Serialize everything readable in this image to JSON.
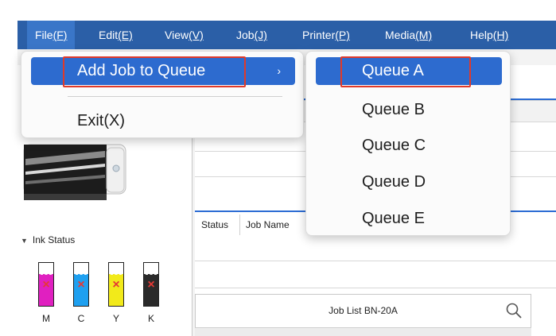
{
  "menubar": {
    "items": [
      {
        "label": "File",
        "key": "(F)"
      },
      {
        "label": "Edit",
        "key": "(E)"
      },
      {
        "label": "View",
        "key": "(V)"
      },
      {
        "label": "Job",
        "key": "(J)"
      },
      {
        "label": "Printer",
        "key": "(P)"
      },
      {
        "label": "Media",
        "key": "(M)"
      },
      {
        "label": "Help",
        "key": "(H)"
      }
    ]
  },
  "file_menu": {
    "add_job": "Add Job to Queue",
    "exit": "Exit(X)",
    "submenu_arrow": "›"
  },
  "queue_menu": {
    "items": [
      "Queue A",
      "Queue B",
      "Queue C",
      "Queue D",
      "Queue E"
    ]
  },
  "ink": {
    "title": "Ink Status",
    "cartridges": [
      {
        "label": "M",
        "color": "#e020c0"
      },
      {
        "label": "C",
        "color": "#1ea0f0"
      },
      {
        "label": "Y",
        "color": "#f2ea1a"
      },
      {
        "label": "K",
        "color": "#2a2a2a"
      }
    ]
  },
  "job_table": {
    "columns": [
      "Status",
      "Job Name"
    ]
  },
  "job_list": {
    "title": "Job List BN-20A"
  },
  "colors": {
    "menubar": "#2b5fa7",
    "highlight": "#2d6bcf",
    "annotation": "#e03a2a"
  }
}
